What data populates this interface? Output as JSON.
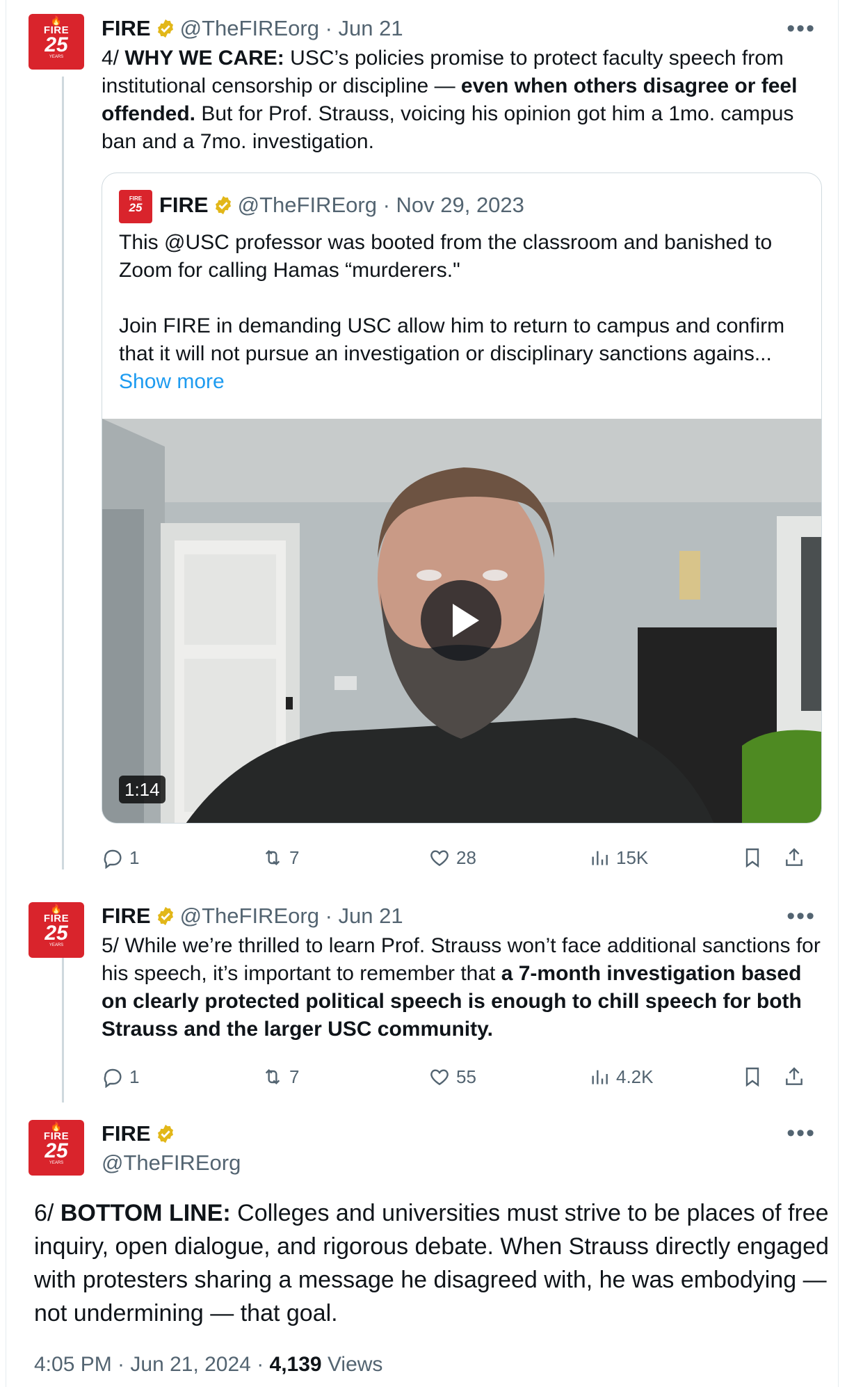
{
  "colors": {
    "fire_red": "#d9242c",
    "link_blue": "#1d9bf0",
    "muted": "#536471",
    "badge_gold": "#f4b400"
  },
  "avatar": {
    "flame": "🔥",
    "fire": "FIRE",
    "num": "25",
    "years": "YEARS"
  },
  "tweet4": {
    "name": "FIRE",
    "handle": "@TheFIREorg",
    "date": "· Jun 21",
    "more": "•••",
    "text_a": "4/ ",
    "text_b": "WHY WE CARE:",
    "text_c": " USC’s policies promise to protect faculty speech from institutional censorship or discipline — ",
    "text_d": "even when others disagree or feel offended.",
    "text_e": " But for Prof. Strauss, voicing his opinion got him a 1mo. campus ban and a 7mo. investigation.",
    "quote": {
      "name": "FIRE",
      "handle": "@TheFIREorg",
      "date": "· Nov 29, 2023",
      "para1": "This @USC professor was booted from the classroom and banished to Zoom for calling Hamas “murderers.\"",
      "para2": "Join FIRE in demanding USC allow him to return to campus and confirm that it will not pursue an investigation or disciplinary sanctions agains...",
      "show_more": "Show more",
      "video_duration": "1:14"
    },
    "actions": {
      "replies": "1",
      "reposts": "7",
      "likes": "28",
      "views": "15K"
    }
  },
  "tweet5": {
    "name": "FIRE",
    "handle": "@TheFIREorg",
    "date": "· Jun 21",
    "more": "•••",
    "text_a": "5/ While we’re thrilled to learn Prof. Strauss won’t face additional sanctions for his speech, it’s important to remember that ",
    "text_b": "a 7-month investigation based on clearly protected political speech is enough to chill speech for both Strauss and the larger USC community.",
    "actions": {
      "replies": "1",
      "reposts": "7",
      "likes": "55",
      "views": "4.2K"
    }
  },
  "tweet6": {
    "name": "FIRE",
    "handle": "@TheFIREorg",
    "more": "•••",
    "text_a": "6/ ",
    "text_b": "BOTTOM LINE:",
    "text_c": " Colleges and universities must strive to be places of free inquiry, open dialogue, and rigorous debate. When Strauss directly engaged with protesters sharing a message he disagreed with, he was embodying — not undermining — that goal.",
    "time": "4:05 PM · Jun 21, 2024 · ",
    "views_count": "4,139",
    "views_label": " Views"
  }
}
